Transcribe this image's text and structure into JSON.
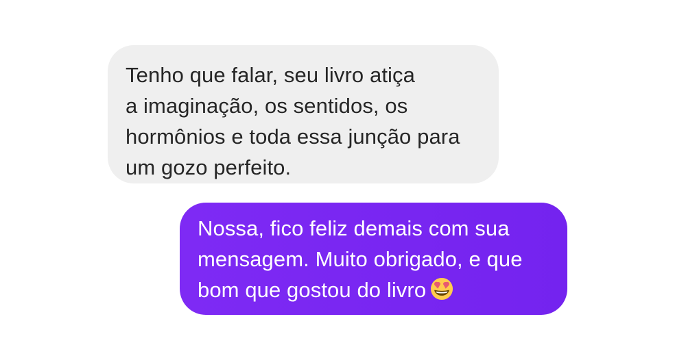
{
  "messages": [
    {
      "direction": "received",
      "lines": [
        "Tenho que falar, seu livro atiça",
        "a imaginação, os sentidos, os",
        "hormônios e toda essa junção para",
        "um gozo perfeito."
      ]
    },
    {
      "direction": "sent",
      "lines": [
        "Nossa, fico feliz demais com sua",
        "mensagem. Muito obrigado, e que",
        "bom que gostou do livro"
      ],
      "emoji": "heart-eyes-emoji"
    }
  ],
  "colors": {
    "received_bubble": "#efefef",
    "received_text": "#262626",
    "sent_bubble": "#7a26f2",
    "sent_text": "#ffffff"
  }
}
